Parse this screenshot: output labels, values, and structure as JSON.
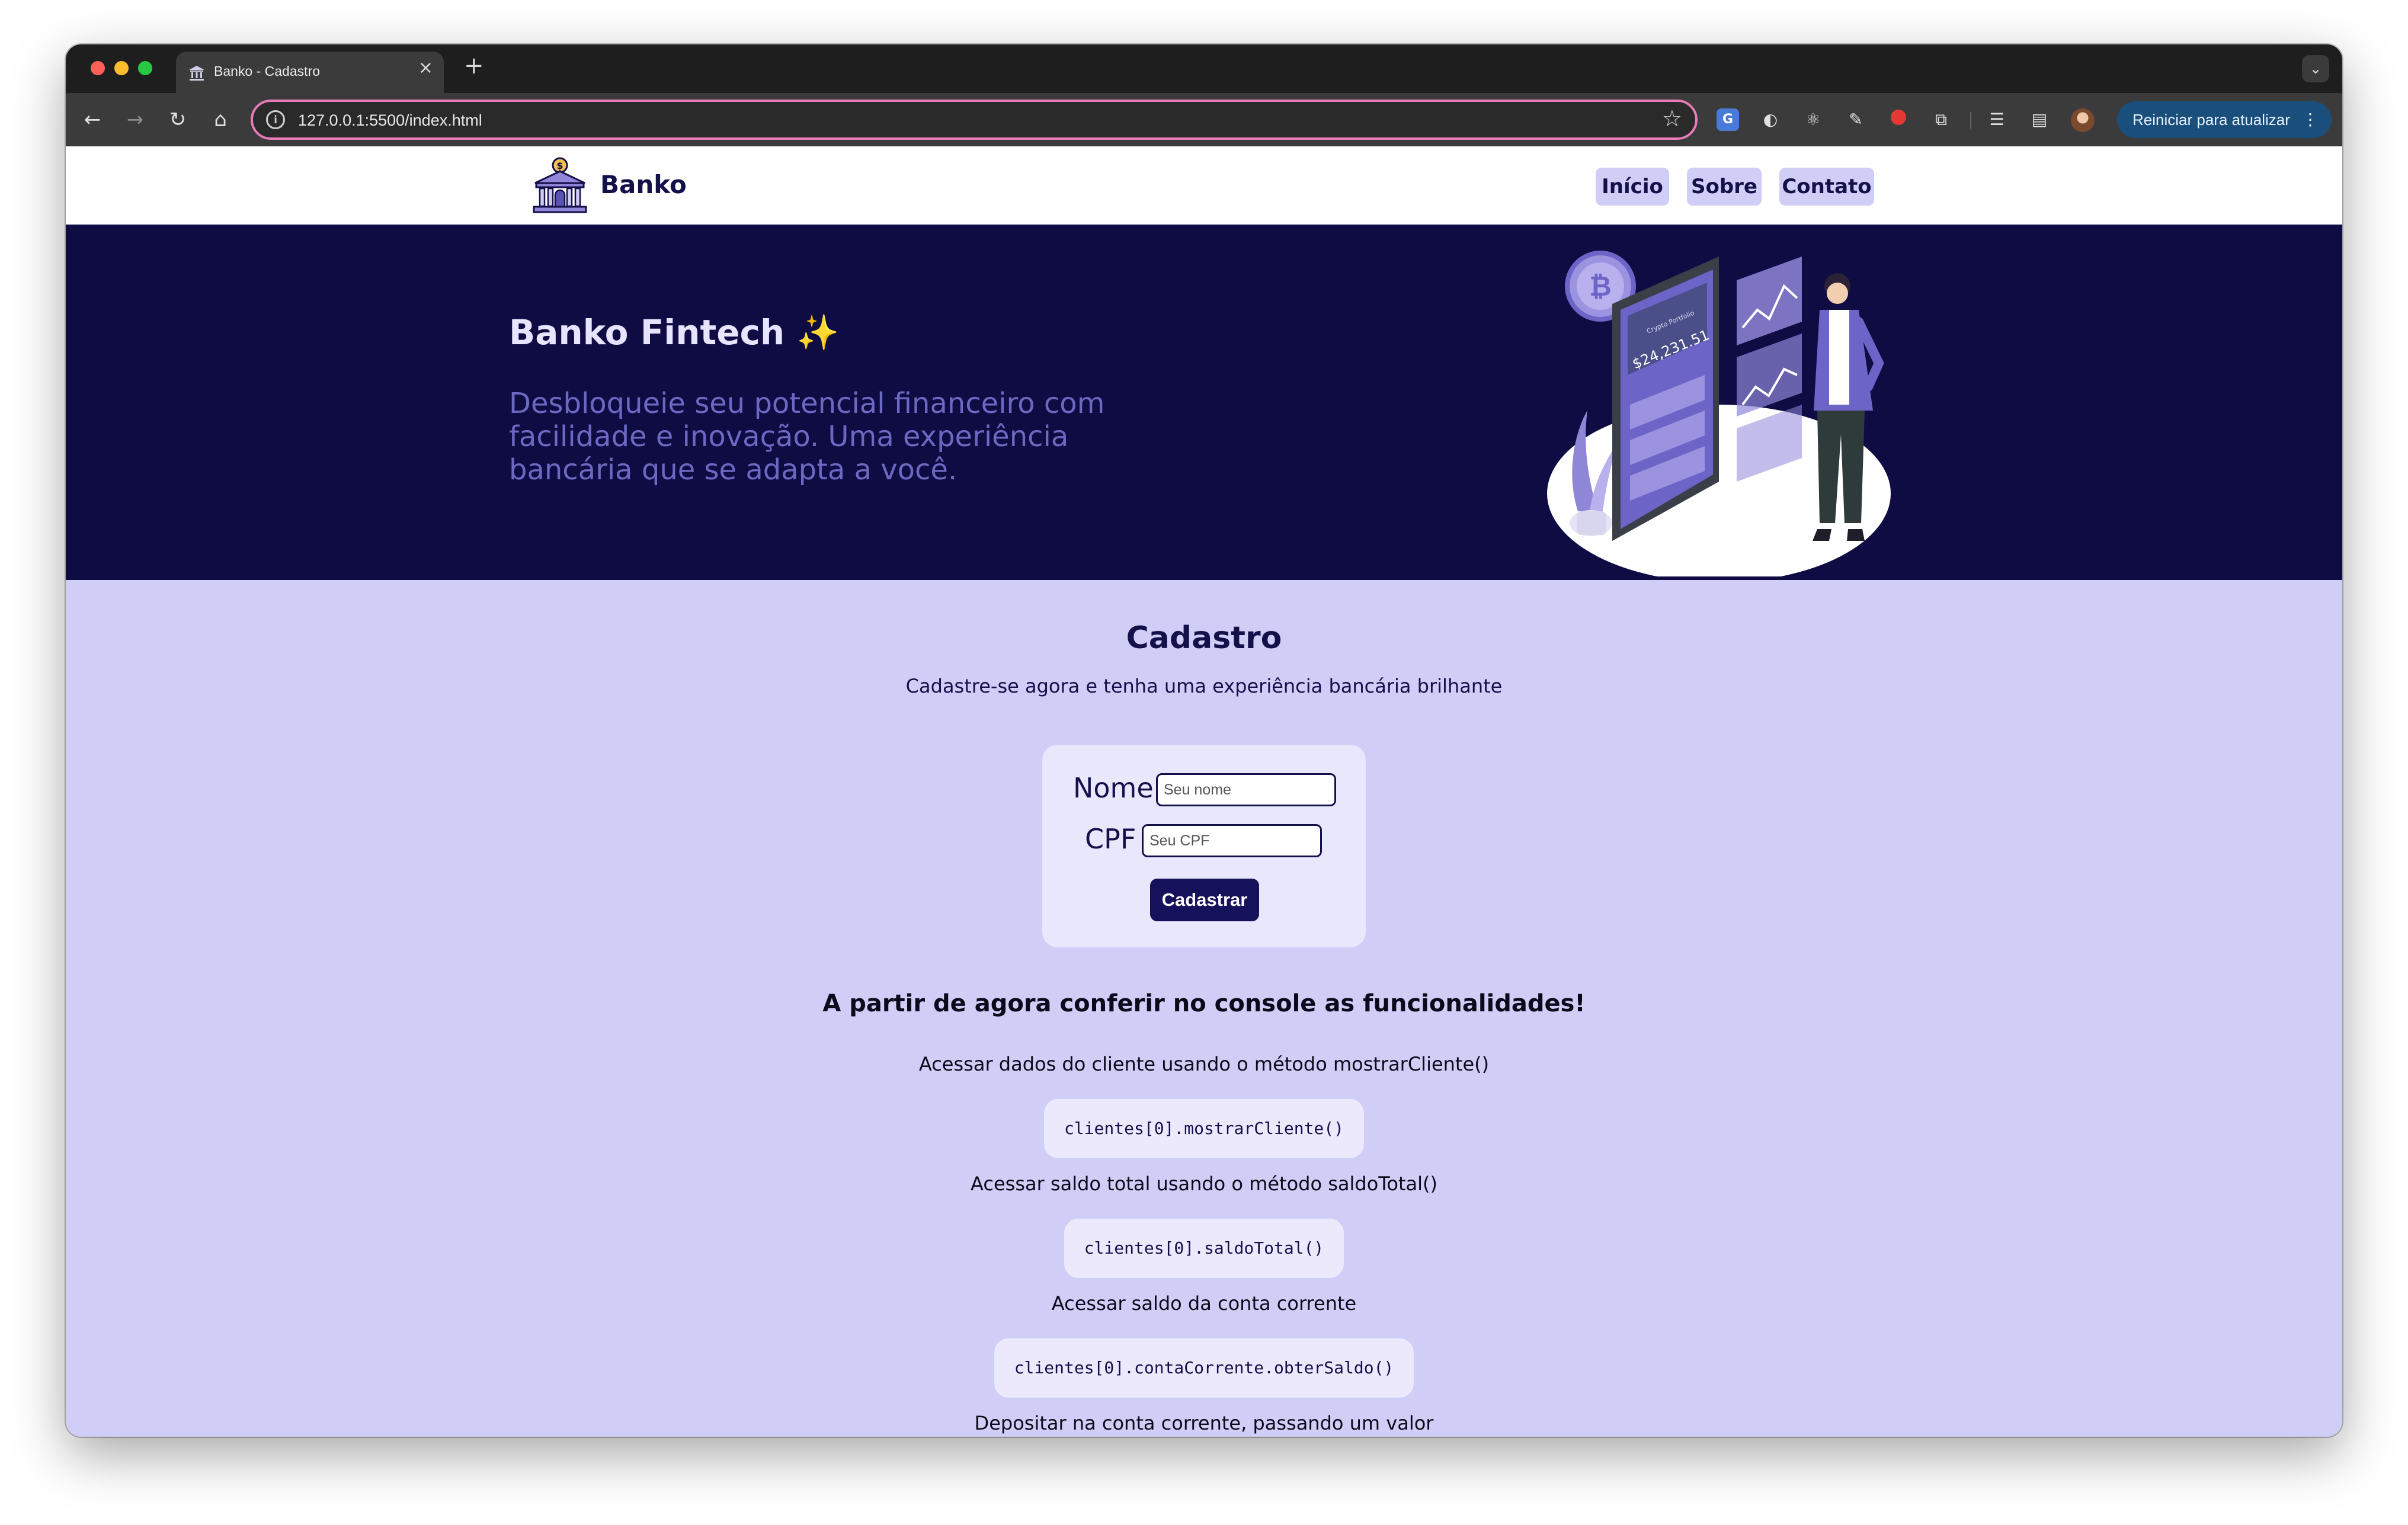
{
  "browser": {
    "tab_title": "Banko - Cadastro",
    "tab_close": "×",
    "new_tab": "+",
    "tab_menu": "⌄",
    "url": "127.0.0.1:5500/index.html",
    "update_button": "Reiniciar para atualizar",
    "icons": {
      "back": "←",
      "forward": "→",
      "reload": "↻",
      "home": "⌂",
      "star": "☆",
      "info": "i",
      "translate": "G",
      "extension_2": "◐",
      "react": "⚛",
      "pen": "✎",
      "puzzle": "⧉",
      "queue": "☰",
      "side_panel": "▤",
      "menu": "⋮"
    }
  },
  "site": {
    "brand": "Banko",
    "nav": {
      "inicio": "Início",
      "sobre": "Sobre",
      "contato": "Contato"
    }
  },
  "hero": {
    "title": "Banko Fintech",
    "sparkle": "✨",
    "subtitle": "Desbloqueie seu potencial financeiro com facilidade e inovação. Uma experiência bancária que se adapta a você.",
    "illustration": {
      "balance": "$24,231.51",
      "app_label": "Crypto Portfolio"
    }
  },
  "cadastro": {
    "title": "Cadastro",
    "subtitle": "Cadastre-se agora e tenha uma experiência bancária brilhante",
    "nome_label": "Nome",
    "nome_placeholder": "Seu nome",
    "cpf_label": "CPF",
    "cpf_placeholder": "Seu CPF",
    "submit": "Cadastrar"
  },
  "console": {
    "heading": "A partir de agora conferir no console as funcionalidades!",
    "items": [
      {
        "description": "Acessar dados do cliente usando o método mostrarCliente()",
        "code": "clientes[0].mostrarCliente()"
      },
      {
        "description": "Acessar saldo total usando o método saldoTotal()",
        "code": "clientes[0].saldoTotal()"
      },
      {
        "description": "Acessar saldo da conta corrente",
        "code": "clientes[0].contaCorrente.obterSaldo()"
      },
      {
        "description": "Depositar na conta corrente, passando um valor",
        "code": ""
      }
    ]
  },
  "colors": {
    "navy": "#0f0c44",
    "lavender": "#d0cdf7",
    "card": "#e9e7fc",
    "hero_subtitle": "#6d68c2",
    "button": "#15115a",
    "omnibox_border": "#e87bb8",
    "update_button": "#1a4f7c"
  }
}
